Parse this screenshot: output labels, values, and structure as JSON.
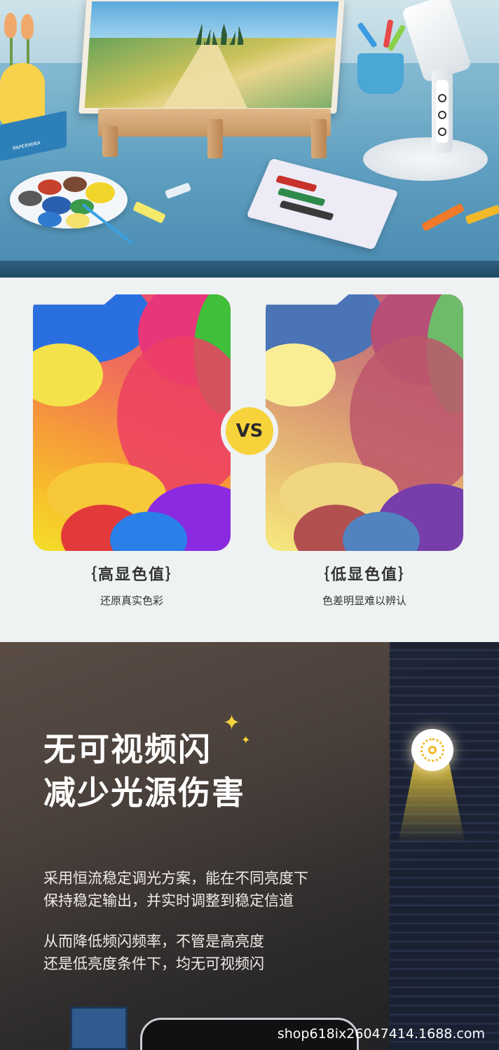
{
  "comparison": {
    "vs_label": "VS",
    "left": {
      "title": "｛高显色值｝",
      "subtitle": "还原真实色彩"
    },
    "right": {
      "title": "｛低显色值｝",
      "subtitle": "色差明显难以辨认"
    }
  },
  "flicker": {
    "headline_line1": "无可视频闪",
    "headline_line2": "减少光源伤害",
    "paragraph1_line1": "采用恒流稳定调光方案，能在不同亮度下",
    "paragraph1_line2": "保持稳定输出，并实时调整到稳定信道",
    "paragraph2_line1": "从而降低频闪频率，不管是高亮度",
    "paragraph2_line2": "还是低亮度条件下，均无可视频闪",
    "accent_color": "#f7d33b"
  },
  "watermark": "shop618ix26047414.1688.com",
  "book_spine": "PAPERMIRA"
}
